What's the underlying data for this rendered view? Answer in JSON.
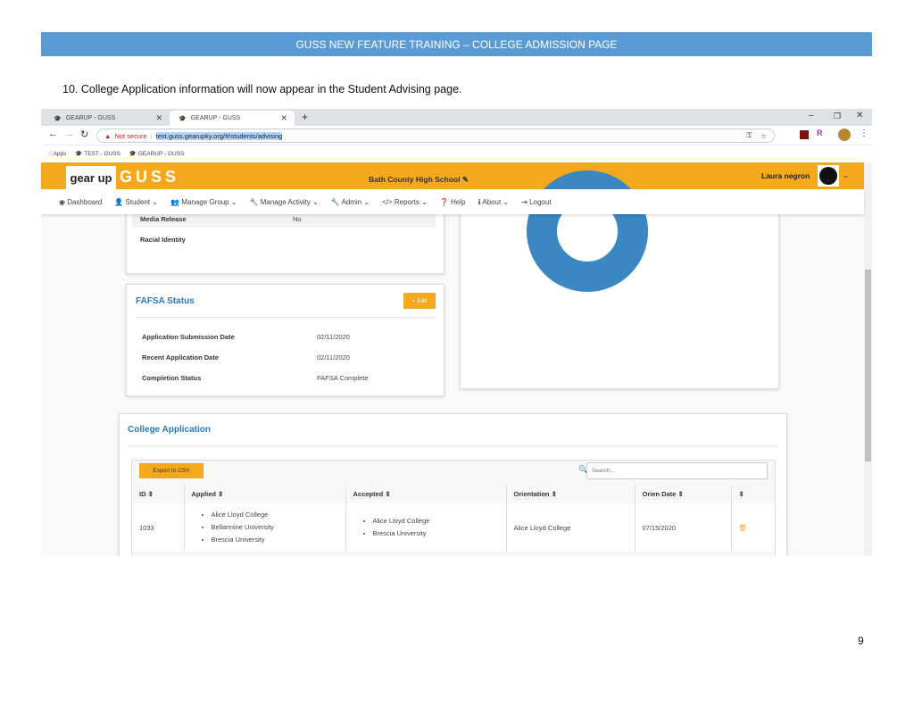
{
  "banner": "GUSS NEW FEATURE TRAINING – COLLEGE ADMISSION PAGE",
  "instruction": "10. College Application information will now appear in the Student Advising page.",
  "browser": {
    "tabs": [
      {
        "label": "GEARUP - GUSS"
      },
      {
        "label": "GEARUP - GUSS"
      }
    ],
    "not_secure": "Not secure",
    "url": "test.guss.gearupky.org/#/students/advising",
    "bookmarks": [
      "Apps",
      "TEST - GUSS",
      "GEARUP - GUSS"
    ]
  },
  "app": {
    "logo": "gear up",
    "brand": "GUSS",
    "school": "Bath County High School",
    "user": "Laura negron",
    "nav": [
      "Dashboard",
      "Student",
      "Manage Group",
      "Manage Activity",
      "Admin",
      "Reports",
      "Help",
      "About",
      "Logout"
    ]
  },
  "profile": {
    "rows": [
      {
        "label": "Media Release",
        "value": "No"
      },
      {
        "label": "Racial Identity",
        "value": ""
      }
    ]
  },
  "fafsa": {
    "title": "FAFSA Status",
    "edit": "Edit",
    "rows": [
      {
        "label": "Application Submission Date",
        "value": "02/11/2020"
      },
      {
        "label": "Recent Application Date",
        "value": "02/11/2020"
      },
      {
        "label": "Completion Status",
        "value": "FAFSA Complete"
      }
    ]
  },
  "donut_color": "#3a87c2",
  "college": {
    "title": "College Application",
    "export": "Export to CSV",
    "search_placeholder": "Search...",
    "columns": [
      "ID",
      "Applied",
      "Accepted",
      "Orientation",
      "Orien Date",
      ""
    ],
    "rows": [
      {
        "id": "1033",
        "applied": [
          "Alice Lloyd College",
          "Bellarmine University",
          "Brescia University"
        ],
        "accepted": [
          "Alice Lloyd College",
          "Brescia University"
        ],
        "orientation": "Alice Lloyd College",
        "orien_date": "07/15/2020"
      }
    ]
  },
  "page_number": "9"
}
